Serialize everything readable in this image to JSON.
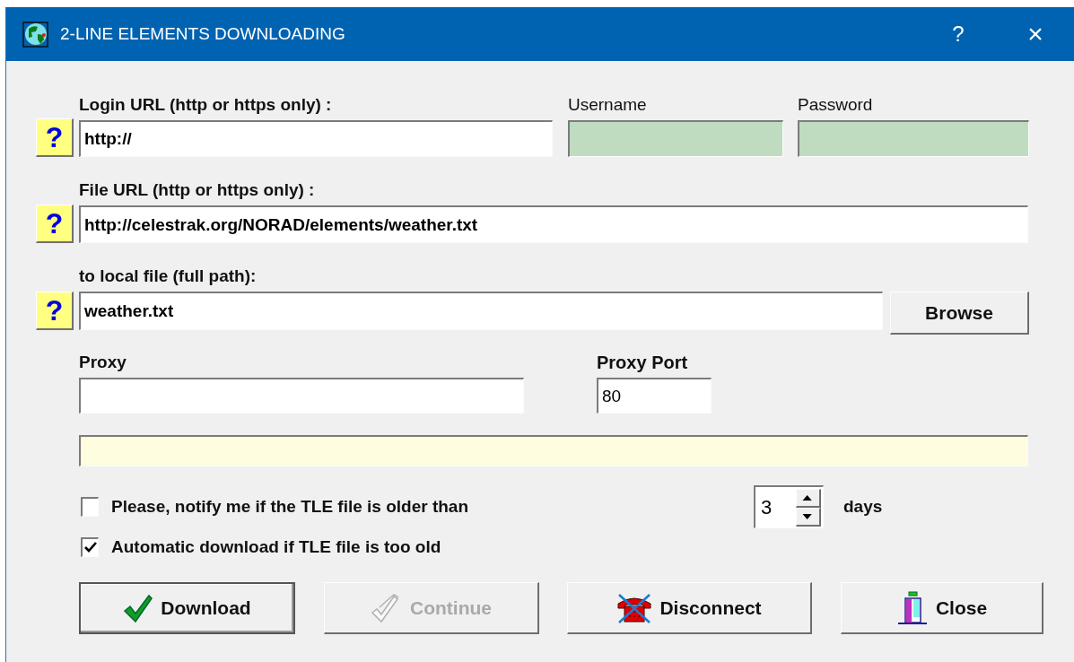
{
  "window": {
    "title": "2-LINE ELEMENTS DOWNLOADING",
    "help_button": "?",
    "close_button": "×"
  },
  "login": {
    "label": "Login URL (http or https only) :",
    "help": "?",
    "value": "http://"
  },
  "username": {
    "label": "Username"
  },
  "password": {
    "label": "Password"
  },
  "file_url": {
    "label": "File URL (http or https only) :",
    "help": "?",
    "value": "http://celestrak.org/NORAD/elements/weather.txt"
  },
  "local_file": {
    "label": "to local file (full path):",
    "help": "?",
    "value": "weather.txt",
    "browse_button": "Browse"
  },
  "proxy": {
    "label": "Proxy"
  },
  "proxy_port": {
    "label": "Proxy Port",
    "value": "80"
  },
  "options": [
    {
      "label": "Please, notify me if the TLE file is older than",
      "checked": false
    },
    {
      "label": "Automatic download if TLE file is too old",
      "checked": true
    }
  ],
  "age_limit": {
    "value": "3",
    "unit": "days"
  },
  "buttons": [
    {
      "label": "Download",
      "kind": "download",
      "disabled": false,
      "default": true
    },
    {
      "label": "Continue",
      "kind": "continue",
      "disabled": true,
      "default": false
    },
    {
      "label": "Disconnect",
      "kind": "disconnect",
      "disabled": false,
      "default": false
    },
    {
      "label": "Close",
      "kind": "close",
      "disabled": false,
      "default": false
    }
  ]
}
